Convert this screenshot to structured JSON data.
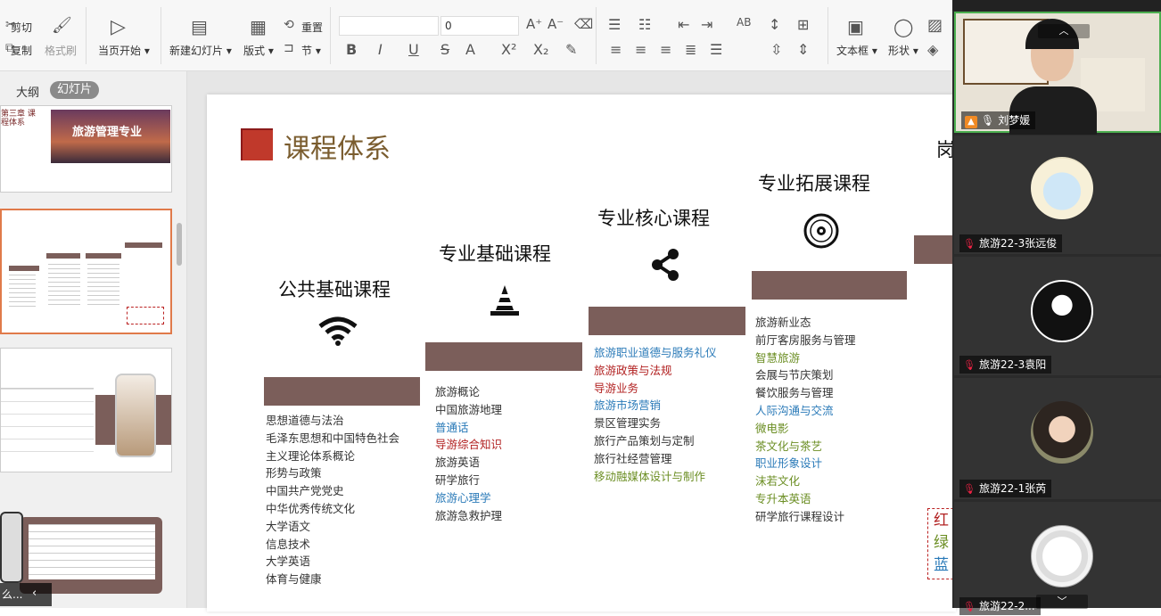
{
  "ribbon": {
    "cut": "剪切",
    "copy": "复制",
    "format_painter": "格式刷",
    "from_current": "当页开始",
    "new_slide": "新建幻灯片",
    "layout": "版式",
    "reset": "重置",
    "section": "节",
    "font_size": "0",
    "textbox": "文本框",
    "shape": "形状"
  },
  "sidebar": {
    "tab_outline": "大纲",
    "tab_slides": "幻灯片",
    "thumb1_title": "旅游管理专业",
    "thumb1_side": "第三章 课程体系",
    "thumb4_caption": "么..."
  },
  "slide": {
    "title": "课程体系",
    "cut_heading": "岗",
    "columns": [
      {
        "heading": "公共基础课程",
        "icon": "wifi-icon",
        "items": [
          {
            "t": "思想道德与法治",
            "c": ""
          },
          {
            "t": "毛泽东思想和中国特色社会",
            "c": ""
          },
          {
            "t": "主义理论体系概论",
            "c": ""
          },
          {
            "t": "形势与政策",
            "c": ""
          },
          {
            "t": "中国共产党党史",
            "c": ""
          },
          {
            "t": "中华优秀传统文化",
            "c": ""
          },
          {
            "t": "大学语文",
            "c": ""
          },
          {
            "t": "信息技术",
            "c": ""
          },
          {
            "t": "大学英语",
            "c": ""
          },
          {
            "t": "体育与健康",
            "c": ""
          }
        ]
      },
      {
        "heading": "专业基础课程",
        "icon": "cone-icon",
        "items": [
          {
            "t": "旅游概论",
            "c": ""
          },
          {
            "t": "中国旅游地理",
            "c": ""
          },
          {
            "t": "普通话",
            "c": "blue"
          },
          {
            "t": "导游综合知识",
            "c": "red"
          },
          {
            "t": "旅游英语",
            "c": ""
          },
          {
            "t": "研学旅行",
            "c": ""
          },
          {
            "t": "旅游心理学",
            "c": "blue"
          },
          {
            "t": "旅游急救护理",
            "c": ""
          }
        ]
      },
      {
        "heading": "专业核心课程",
        "icon": "share-icon",
        "items": [
          {
            "t": "旅游职业道德与服务礼仪",
            "c": "blue"
          },
          {
            "t": "旅游政策与法规",
            "c": "red"
          },
          {
            "t": "导游业务",
            "c": "red"
          },
          {
            "t": "旅游市场营销",
            "c": "blue"
          },
          {
            "t": "景区管理实务",
            "c": ""
          },
          {
            "t": "旅行产品策划与定制",
            "c": ""
          },
          {
            "t": "旅行社经营管理",
            "c": ""
          },
          {
            "t": "移动融媒体设计与制作",
            "c": "green"
          }
        ]
      },
      {
        "heading": "专业拓展课程",
        "icon": "disc-icon",
        "items": [
          {
            "t": "旅游新业态",
            "c": ""
          },
          {
            "t": "前厅客房服务与管理",
            "c": ""
          },
          {
            "t": "智慧旅游",
            "c": "green"
          },
          {
            "t": "会展与节庆策划",
            "c": ""
          },
          {
            "t": "餐饮服务与管理",
            "c": ""
          },
          {
            "t": "人际沟通与交流",
            "c": "blue"
          },
          {
            "t": "微电影",
            "c": "green"
          },
          {
            "t": "茶文化与茶艺",
            "c": "green"
          },
          {
            "t": "职业形象设计",
            "c": "blue"
          },
          {
            "t": "沫若文化",
            "c": "green"
          },
          {
            "t": "专升本英语",
            "c": "green"
          },
          {
            "t": "研学旅行课程设计",
            "c": ""
          }
        ]
      }
    ],
    "legend": [
      "红",
      "绿",
      "蓝"
    ]
  },
  "participants": [
    {
      "name": "刘梦媛",
      "role": "host"
    },
    {
      "name": "旅游22-3张远俊"
    },
    {
      "name": "旅游22-3袁阳"
    },
    {
      "name": "旅游22-1张芮"
    },
    {
      "name": "旅游22-2..."
    }
  ],
  "colors": {
    "bar": "#7b5e5a",
    "title": "#7a5c2e",
    "red": "#b22222",
    "blue": "#2a7ab8",
    "green": "#6b8e23",
    "active_speaker": "#4caf50"
  }
}
